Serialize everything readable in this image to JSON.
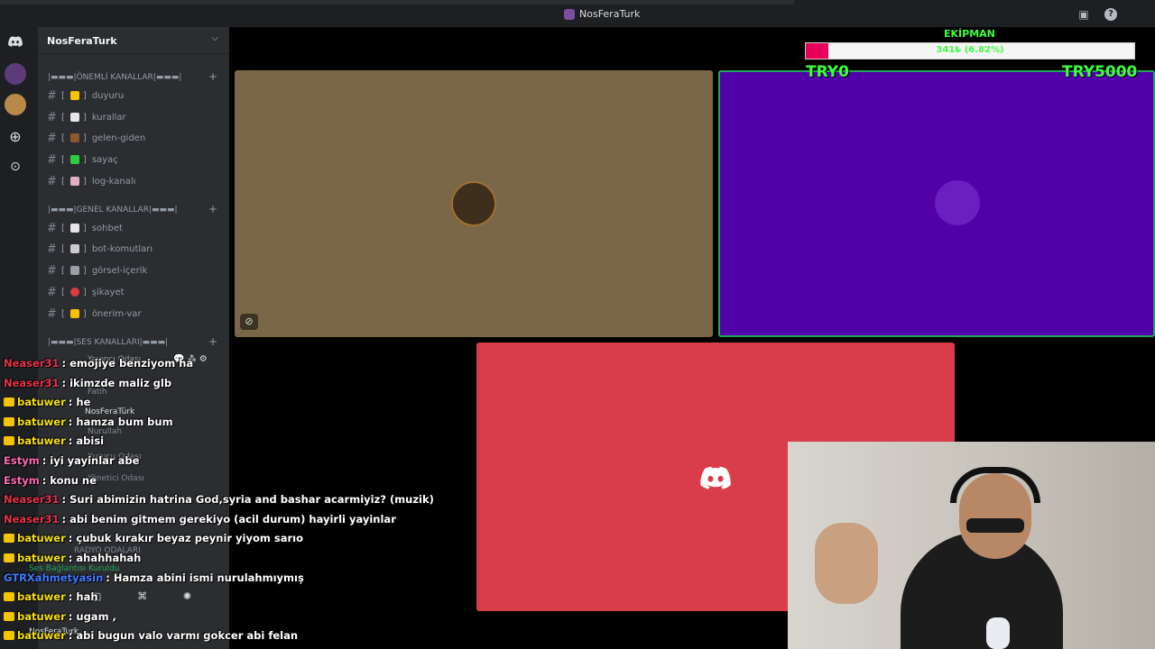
{
  "window": {
    "title": "NosFeraTurk"
  },
  "server": {
    "name": "NosFeraTurk"
  },
  "categories": [
    {
      "label": "|▬▬▬|ÖNEMLİ KANALLAR|▬▬▬|"
    },
    {
      "label": "|▬▬▬|GENEL KANALLAR|▬▬▬|"
    },
    {
      "label": "|▬▬▬|SES KANALLARI|▬▬▬|"
    }
  ],
  "channels": [
    {
      "name": "duyuru",
      "emoji_color": "#f5c400"
    },
    {
      "name": "kurallar",
      "emoji_color": "#e6e6e6"
    },
    {
      "name": "gelen-giden",
      "emoji_color": "#8a5a2b"
    },
    {
      "name": "sayaç",
      "emoji_color": "#2ecc40"
    },
    {
      "name": "log-kanalı",
      "emoji_color": "#e0b0c0"
    },
    {
      "name": "sohbet",
      "emoji_color": "#e6e6e6"
    },
    {
      "name": "bot-komutları",
      "emoji_color": "#cccccc"
    },
    {
      "name": "görsel-içerik",
      "emoji_color": "#9aa0a6"
    },
    {
      "name": "şikayet",
      "emoji_color": "#e0393e"
    },
    {
      "name": "önerim-var",
      "emoji_color": "#f5c400"
    }
  ],
  "voice": {
    "channel": "Yayıncı Odası",
    "users": [
      "Fatih",
      "NosFeraTürk",
      "Nurullah"
    ],
    "other_rooms": [
      "Kurucu Odası",
      "Yönetici Odası"
    ],
    "radio_category": "RADYO ODALARI",
    "status": "Ses Bağlantısı Kuruldu",
    "self_name": "NosFeraTurk"
  },
  "goal": {
    "title": "EKİPMAN",
    "text": "341₺ (6.82%)",
    "fraction": 0.0682,
    "low_label": "TRY0",
    "high_label": "TRY5000"
  },
  "tiles": {
    "tile1_color": "#7a6747",
    "tile2_color": "#5200a8",
    "tile3_color": "#d93d4a"
  },
  "chat": [
    {
      "user": "Neaser31",
      "color": "#e8334a",
      "badge": false,
      "text": ": emojiye benziyom ha"
    },
    {
      "user": "Neaser31",
      "color": "#e8334a",
      "badge": false,
      "text": ": ikimzde maliz glb"
    },
    {
      "user": "batuwer",
      "color": "#f5e000",
      "badge": true,
      "text": ": he"
    },
    {
      "user": "batuwer",
      "color": "#f5e000",
      "badge": true,
      "text": ": hamza bum bum"
    },
    {
      "user": "batuwer",
      "color": "#f5e000",
      "badge": true,
      "text": ": abisi"
    },
    {
      "user": "Estym",
      "color": "#ff69b4",
      "badge": false,
      "text": ": iyi yayinlar abe"
    },
    {
      "user": "Estym",
      "color": "#ff69b4",
      "badge": false,
      "text": ": konu ne"
    },
    {
      "user": "Neaser31",
      "color": "#e8334a",
      "badge": false,
      "text": ": Suri abimizin hatrina God,syria and bashar acarmiyiz? (muzik)"
    },
    {
      "user": "Neaser31",
      "color": "#e8334a",
      "badge": false,
      "text": ": abi benim gitmem gerekiyo (acil durum) hayirli yayinlar"
    },
    {
      "user": "batuwer",
      "color": "#f5e000",
      "badge": true,
      "text": ": çubuk kırakır beyaz peynir yiyom sarıo"
    },
    {
      "user": "batuwer",
      "color": "#f5e000",
      "badge": true,
      "text": ": ahahhahah"
    },
    {
      "user": "GTRXahmetyasin",
      "color": "#3d7bff",
      "badge": false,
      "text": ": Hamza abini ismi nurulahmıymış"
    },
    {
      "user": "batuwer",
      "color": "#f5e000",
      "badge": true,
      "text": ": hah"
    },
    {
      "user": "batuwer",
      "color": "#f5e000",
      "badge": true,
      "text": ": ugam ,"
    },
    {
      "user": "batuwer",
      "color": "#f5e000",
      "badge": true,
      "text": ": abi bugun valo varmı gokcer abi felan"
    }
  ]
}
